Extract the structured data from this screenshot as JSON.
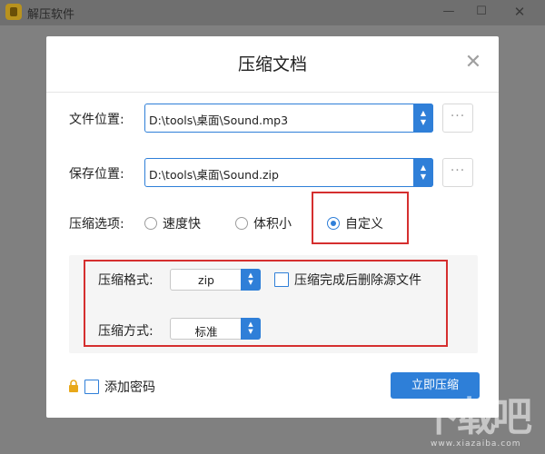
{
  "app": {
    "title": "解压软件",
    "min_glyph": "—",
    "max_glyph": "☐",
    "close_glyph": "✕"
  },
  "dialog": {
    "title": "压缩文档",
    "close_glyph": "✕",
    "file_location": {
      "label": "文件位置:",
      "value": "D:\\tools\\桌面\\Sound.mp3"
    },
    "save_location": {
      "label": "保存位置:",
      "value": "D:\\tools\\桌面\\Sound.zip"
    },
    "browse_glyph": "···",
    "compress_options": {
      "label": "压缩选项:",
      "options": [
        {
          "label": "速度快",
          "checked": false
        },
        {
          "label": "体积小",
          "checked": false
        },
        {
          "label": "自定义",
          "checked": true
        }
      ]
    },
    "custom": {
      "format_label": "压缩格式:",
      "format_value": "zip",
      "delete_source_label": "压缩完成后删除源文件",
      "delete_source_checked": false,
      "method_label": "压缩方式:",
      "method_value": "标准"
    },
    "password_label": "添加密码",
    "password_checked": false,
    "submit_label": "立即压缩"
  },
  "watermark": {
    "main": "下载吧",
    "sub": "www.xiazaiba.com"
  },
  "colors": {
    "accent": "#2e7fd8",
    "highlight": "#d52f2f",
    "lock": "#e8a81a"
  }
}
